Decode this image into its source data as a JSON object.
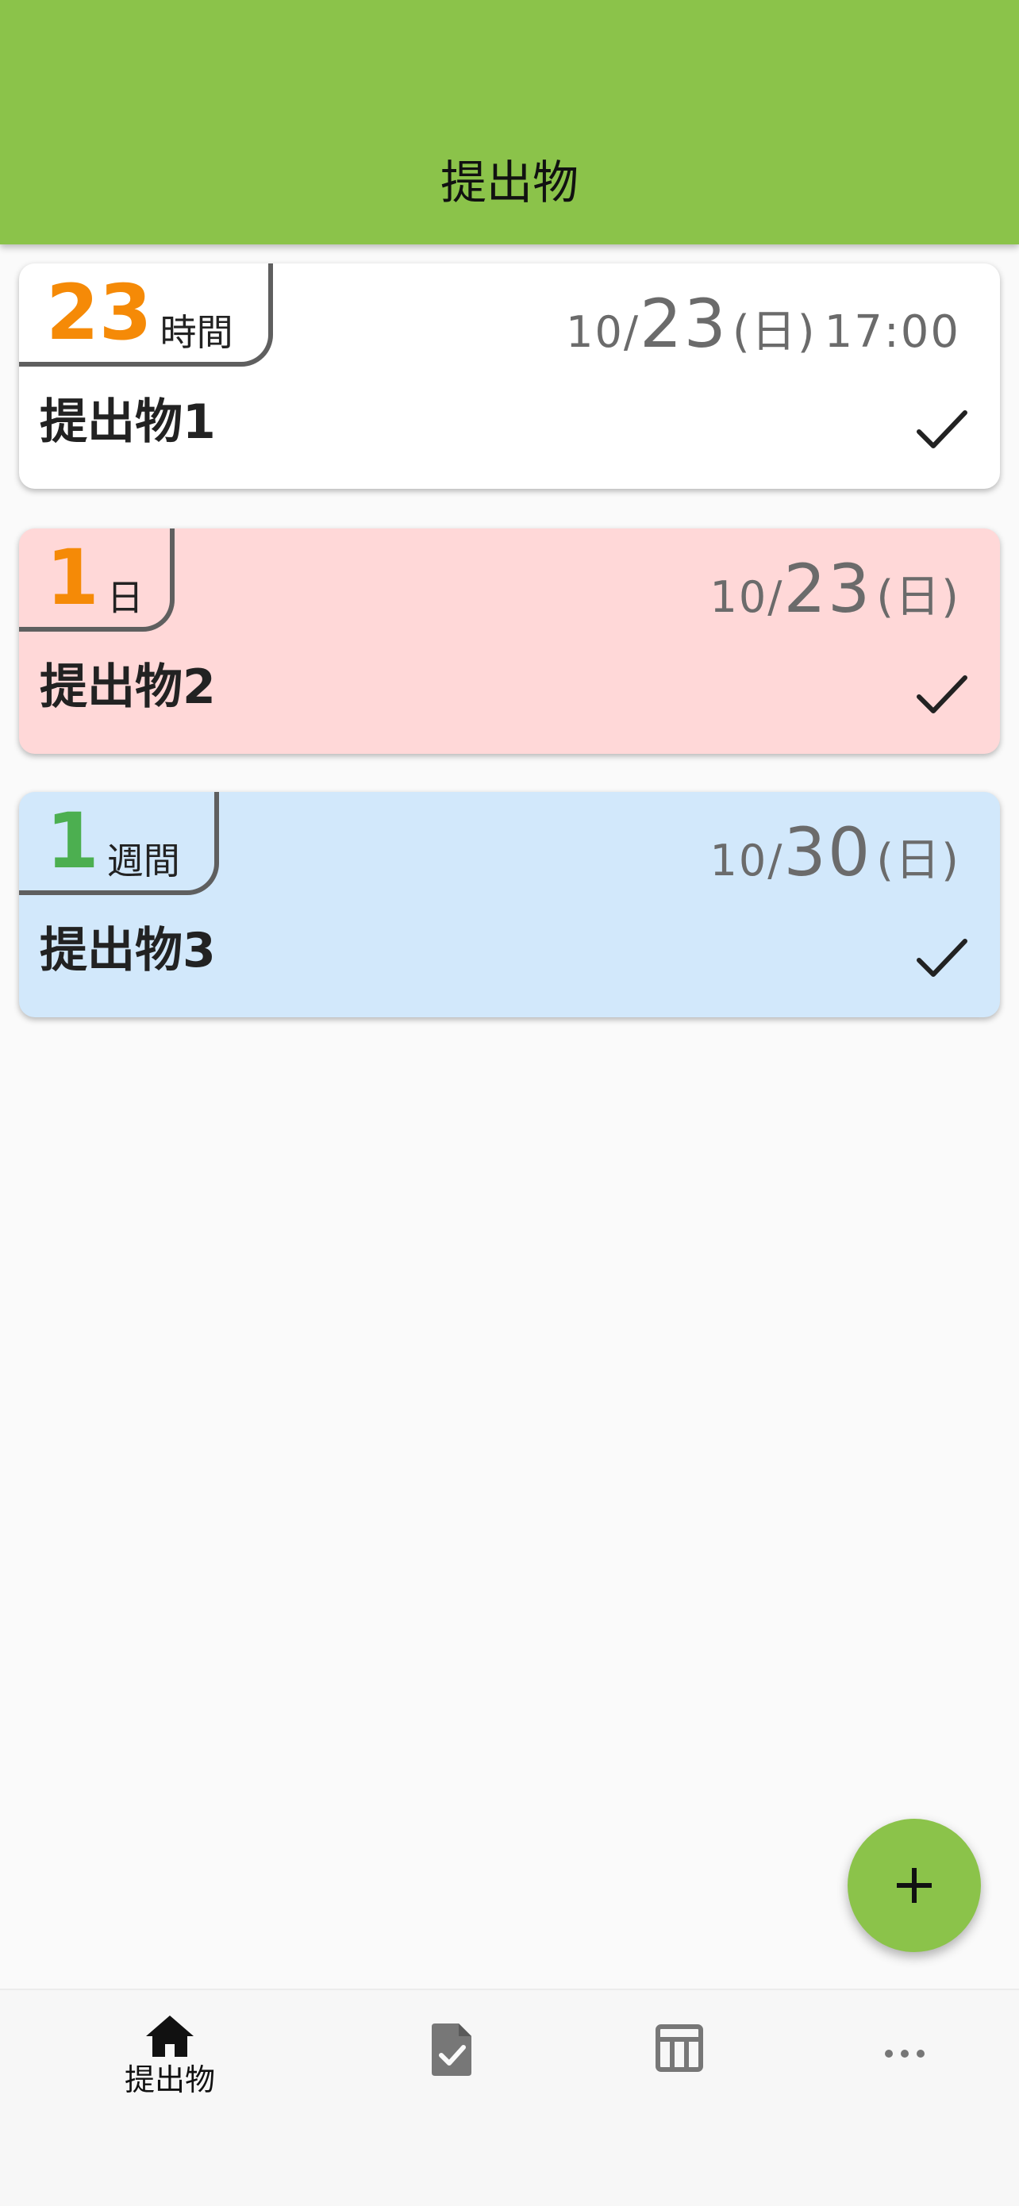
{
  "app_bar": {
    "title": "提出物"
  },
  "colors": {
    "primary": "#8bc34a",
    "badge_orange": "#f58a07",
    "badge_green": "#4caf50",
    "card_white": "#ffffff",
    "card_red": "#ffd8d8",
    "card_blue": "#d2e8fb"
  },
  "cards": [
    {
      "remaining_value": "23",
      "remaining_unit": "時間",
      "date_month": "10",
      "date_day": "23",
      "weekday": "(日)",
      "time": "17:00",
      "title": "提出物1",
      "check_icon": "check-icon"
    },
    {
      "remaining_value": "1",
      "remaining_unit": "日",
      "date_month": "10",
      "date_day": "23",
      "weekday": "(日)",
      "time": "",
      "title": "提出物2",
      "check_icon": "check-icon"
    },
    {
      "remaining_value": "1",
      "remaining_unit": "週間",
      "date_month": "10",
      "date_day": "30",
      "weekday": "(日)",
      "time": "",
      "title": "提出物3",
      "check_icon": "check-icon"
    }
  ],
  "fab": {
    "icon": "plus-icon"
  },
  "bottom_nav": {
    "items": [
      {
        "icon": "home-icon",
        "label": "提出物",
        "active": true
      },
      {
        "icon": "document-check-icon",
        "label": ""
      },
      {
        "icon": "table-icon",
        "label": ""
      },
      {
        "icon": "more-icon",
        "label": ""
      }
    ]
  }
}
